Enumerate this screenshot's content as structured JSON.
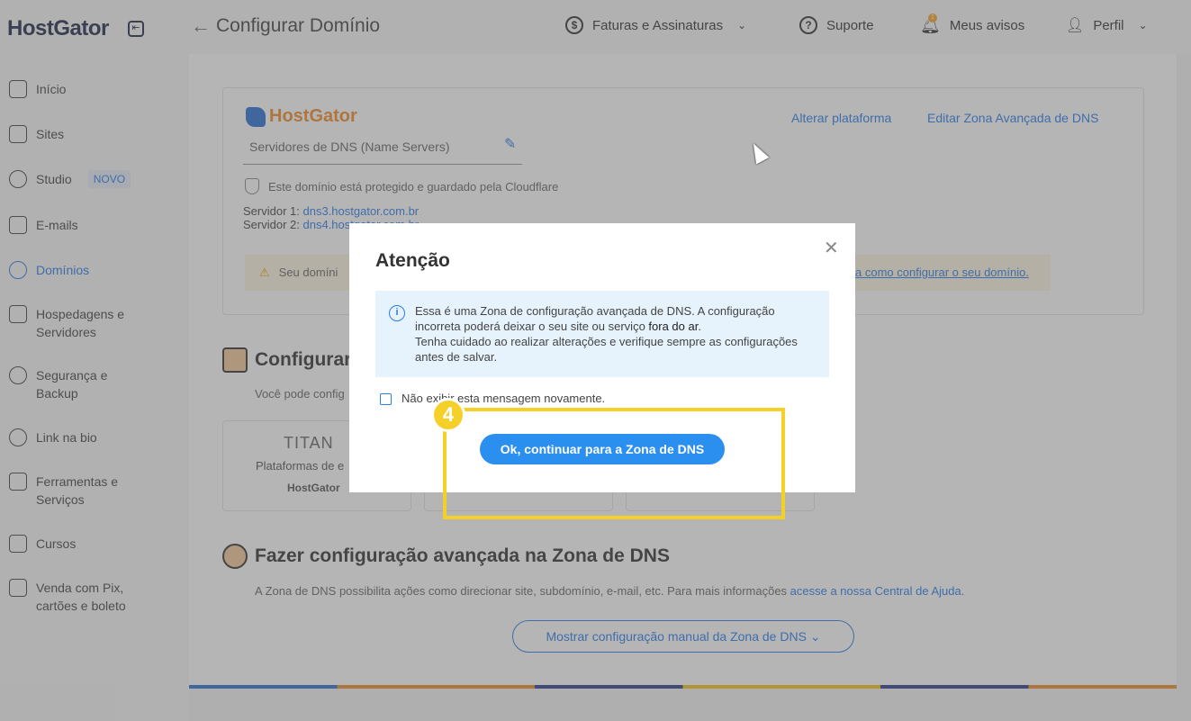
{
  "header": {
    "logo": "HostGator",
    "page_title": "Configurar Domínio",
    "billing": "Faturas e Assinaturas",
    "support": "Suporte",
    "notices": "Meus avisos",
    "notice_count": "1",
    "profile": "Perfil"
  },
  "sidebar": {
    "items": [
      {
        "label": "Início"
      },
      {
        "label": "Sites"
      },
      {
        "label": "Studio",
        "badge": "NOVO"
      },
      {
        "label": "E-mails"
      },
      {
        "label": "Domínios"
      },
      {
        "label": "Hospedagens e Servidores"
      },
      {
        "label": "Segurança e Backup"
      },
      {
        "label": "Link na bio"
      },
      {
        "label": "Ferramentas e Serviços"
      },
      {
        "label": "Cursos"
      },
      {
        "label": "Venda com Pix, cartões e boleto"
      }
    ]
  },
  "dns_card": {
    "brand": "HostGator",
    "ns_label": "Servidores de DNS (Name Servers)",
    "change_platform": "Alterar plataforma",
    "edit_zone": "Editar Zona Avançada de DNS",
    "protected": "Este domínio está protegido e guardado pela Cloudflare",
    "server1_label": "Servidor 1:",
    "server1_value": "dns3.hostgator.com.br",
    "server2_label": "Servidor 2:",
    "server2_value": "dns4.hostgator.com.br",
    "warning_text": "Seu domíni",
    "warning_link": "a como configurar o seu domínio."
  },
  "section_config": {
    "title": "Configurar",
    "subtitle": "Você pode config",
    "titan": "TITAN",
    "platforms_text": "Plataformas de e",
    "hostgator": "HostGator"
  },
  "section_dns": {
    "title": "Fazer configuração avançada na Zona de DNS",
    "desc": "A Zona de DNS possibilita ações como direcionar site, subdomínio, e-mail, etc. Para mais informações ",
    "desc_link": "acesse a nossa Central de Ajuda",
    "desc_end": ".",
    "show_manual": "Mostrar configuração manual da Zona de DNS"
  },
  "modal": {
    "title": "Atenção",
    "info_line1": "Essa é uma Zona de configuração avançada de DNS. A configuração incorreta poderá deixar o seu site ou serviço ",
    "info_bold": "fora do ar",
    "info_line1_end": ".",
    "info_line2": "Tenha cuidado ao realizar alterações e verifique sempre as configurações antes de salvar.",
    "checkbox_label": "Não exibir esta mensagem novamente.",
    "ok_button": "Ok, continuar para a Zona de DNS"
  },
  "annotation": {
    "step": "4",
    "color": "#f5d028"
  },
  "colors": {
    "accent": "#2b7de9",
    "button": "#2b8ff0",
    "brand_orange": "#f28c28"
  }
}
